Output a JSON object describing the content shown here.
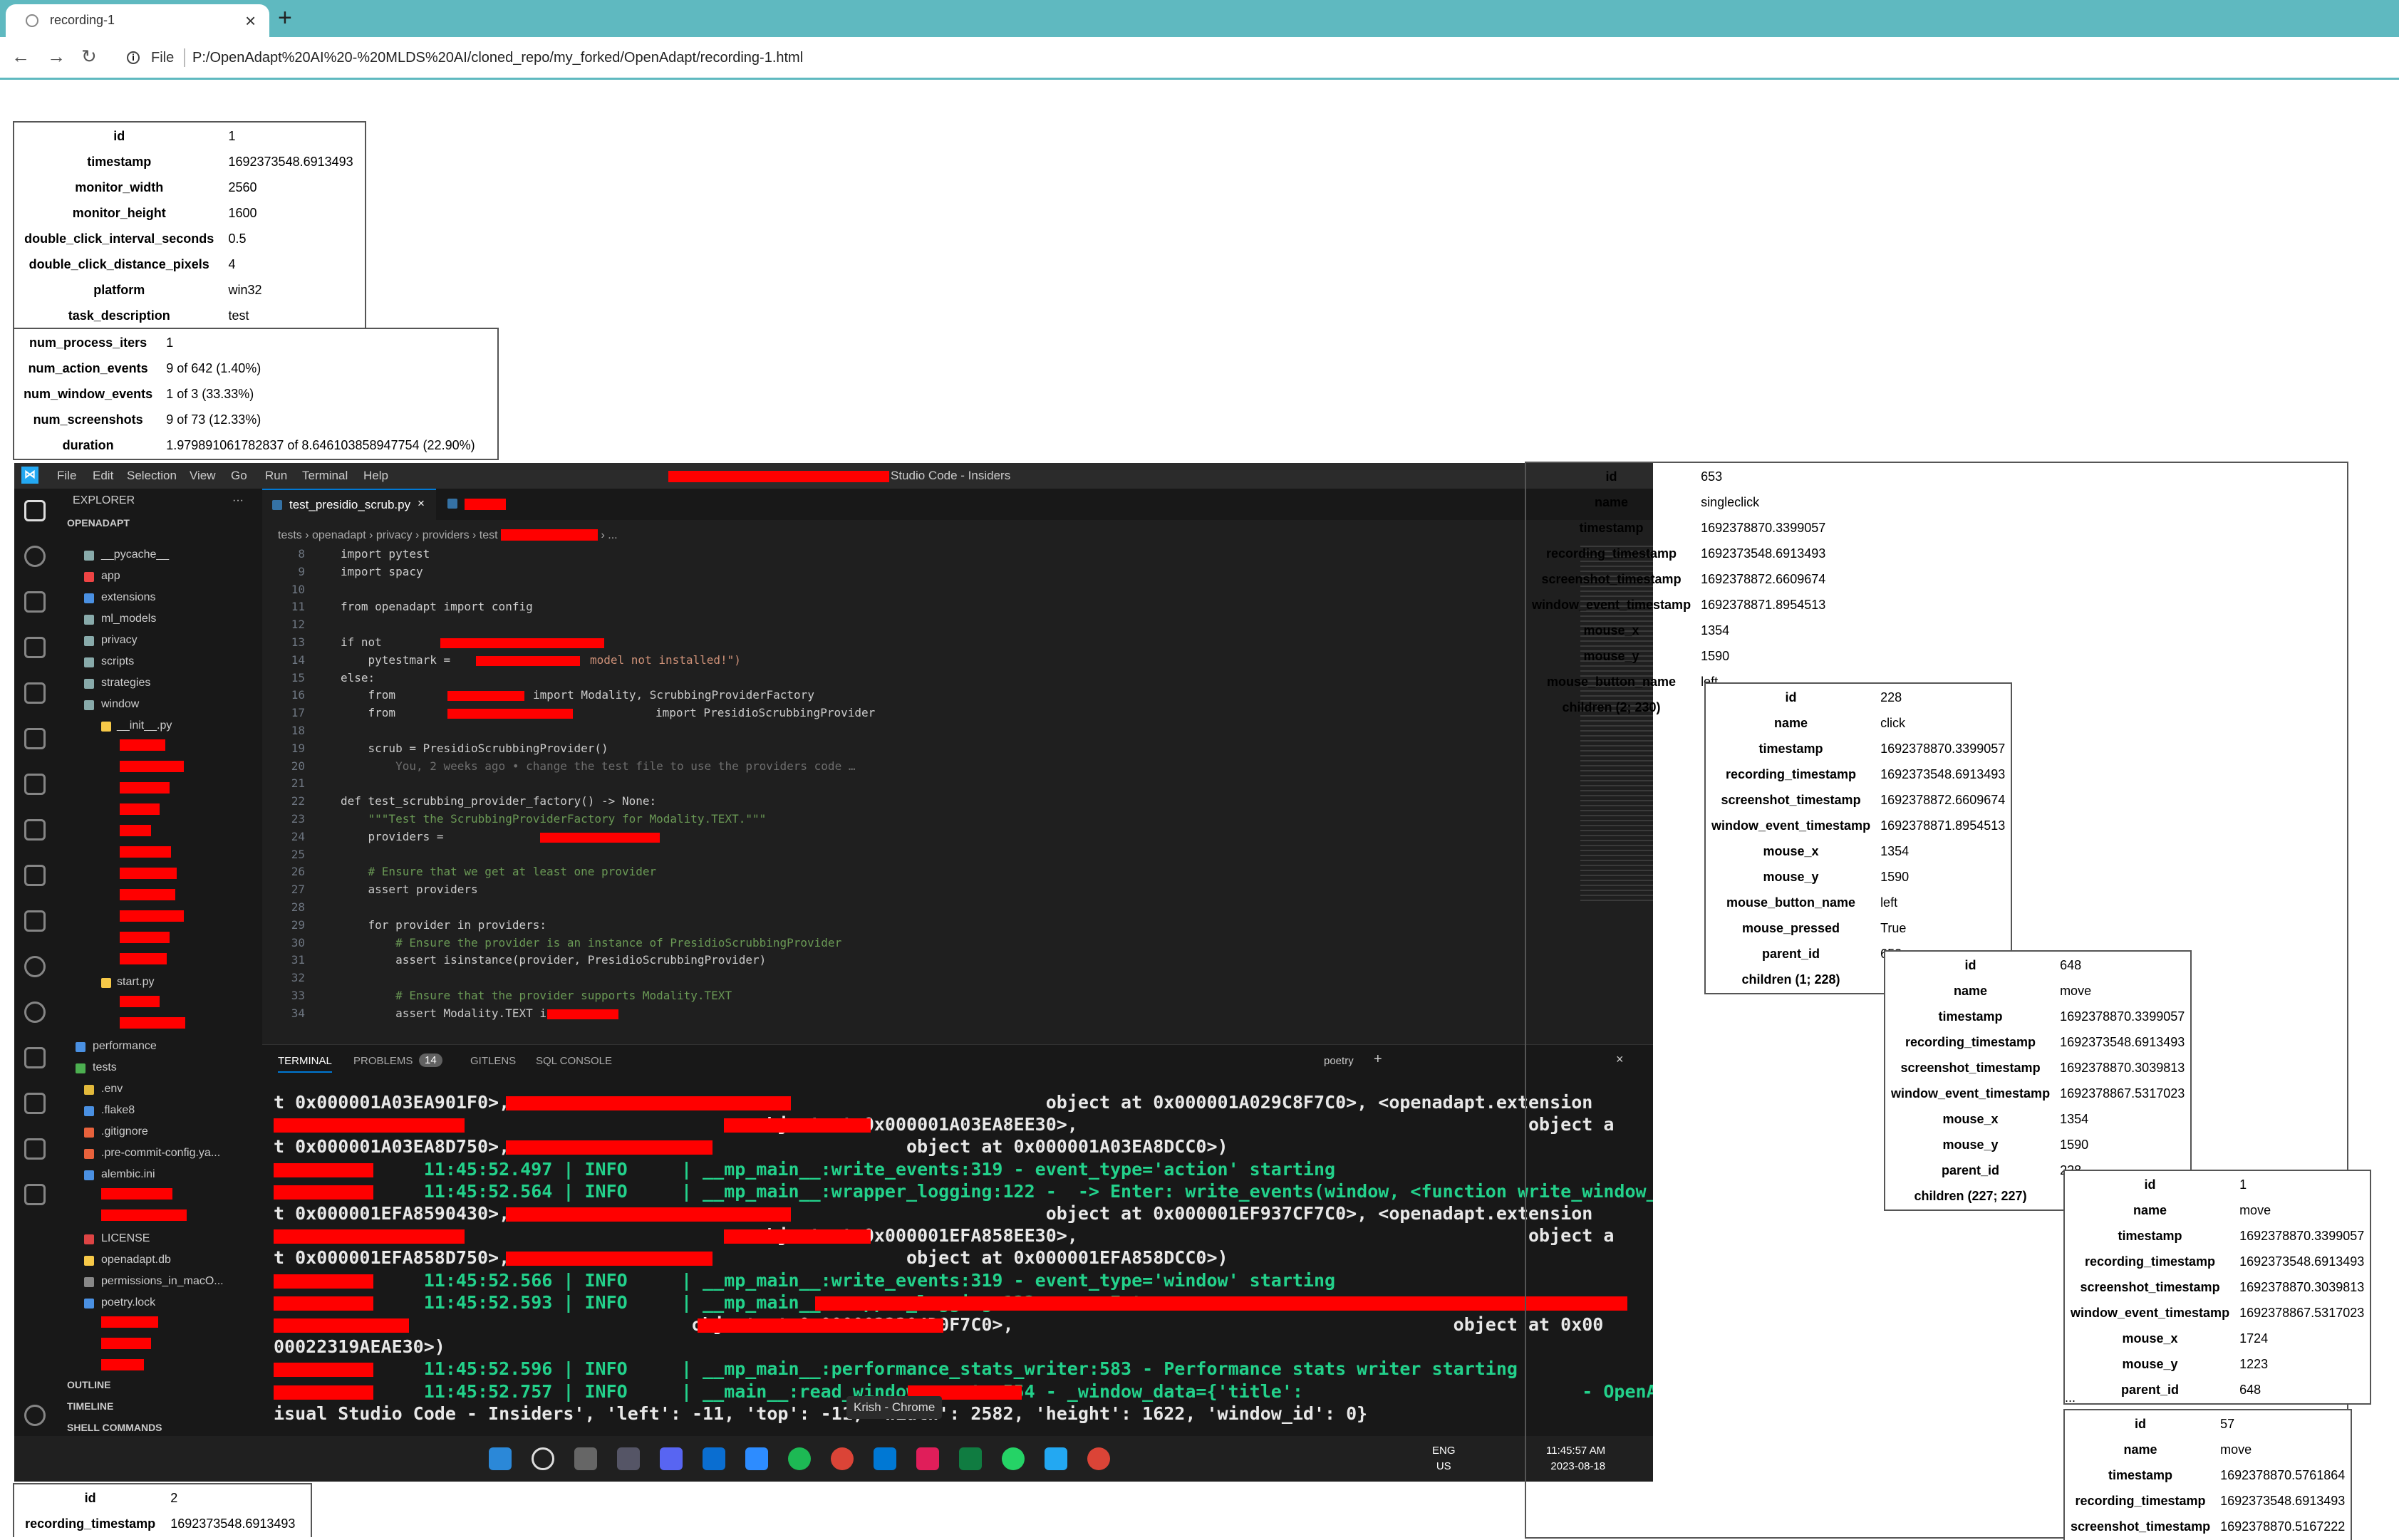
{
  "browser": {
    "tab_title": "recording-1",
    "tab_close": "×",
    "new_tab": "+",
    "back": "←",
    "forward": "→",
    "reload": "↻",
    "info_glyph": "i",
    "file_label": "File",
    "url": "P:/OpenAdapt%20AI%20-%20MLDS%20AI/cloned_repo/my_forked/OpenAdapt/recording-1.html"
  },
  "recording_table": [
    {
      "k": "id",
      "v": "1"
    },
    {
      "k": "timestamp",
      "v": "1692373548.6913493"
    },
    {
      "k": "monitor_width",
      "v": "2560"
    },
    {
      "k": "monitor_height",
      "v": "1600"
    },
    {
      "k": "double_click_interval_seconds",
      "v": "0.5"
    },
    {
      "k": "double_click_distance_pixels",
      "v": "4"
    },
    {
      "k": "platform",
      "v": "win32"
    },
    {
      "k": "task_description",
      "v": "test"
    }
  ],
  "stats_table": [
    {
      "k": "num_process_iters",
      "v": "1"
    },
    {
      "k": "num_action_events",
      "v": "9 of 642 (1.40%)"
    },
    {
      "k": "num_window_events",
      "v": "1 of 3 (33.33%)"
    },
    {
      "k": "num_screenshots",
      "v": "9 of 73 (12.33%)"
    },
    {
      "k": "duration",
      "v": "1.979891061782837 of 8.646103858947754 (22.90%)"
    }
  ],
  "bottom_table": [
    {
      "k": "id",
      "v": "2"
    },
    {
      "k": "recording_timestamp",
      "v": "1692373548.6913493"
    }
  ],
  "event_l1": [
    {
      "k": "id",
      "v": "653"
    },
    {
      "k": "name",
      "v": "singleclick"
    },
    {
      "k": "timestamp",
      "v": "1692378870.3399057"
    },
    {
      "k": "recording_timestamp",
      "v": "1692373548.6913493"
    },
    {
      "k": "screenshot_timestamp",
      "v": "1692378872.6609674"
    },
    {
      "k": "window_event_timestamp",
      "v": "1692378871.8954513"
    },
    {
      "k": "mouse_x",
      "v": "1354"
    },
    {
      "k": "mouse_y",
      "v": "1590"
    },
    {
      "k": "mouse_button_name",
      "v": "left"
    },
    {
      "k": "children (2; 230)",
      "v": ""
    }
  ],
  "event_l2": [
    {
      "k": "id",
      "v": "228"
    },
    {
      "k": "name",
      "v": "click"
    },
    {
      "k": "timestamp",
      "v": "1692378870.3399057"
    },
    {
      "k": "recording_timestamp",
      "v": "1692373548.6913493"
    },
    {
      "k": "screenshot_timestamp",
      "v": "1692378872.6609674"
    },
    {
      "k": "window_event_timestamp",
      "v": "1692378871.8954513"
    },
    {
      "k": "mouse_x",
      "v": "1354"
    },
    {
      "k": "mouse_y",
      "v": "1590"
    },
    {
      "k": "mouse_button_name",
      "v": "left"
    },
    {
      "k": "mouse_pressed",
      "v": "True"
    },
    {
      "k": "parent_id",
      "v": "653"
    },
    {
      "k": "children (1; 228)",
      "v": ""
    }
  ],
  "event_l3": [
    {
      "k": "id",
      "v": "648"
    },
    {
      "k": "name",
      "v": "move"
    },
    {
      "k": "timestamp",
      "v": "1692378870.3399057"
    },
    {
      "k": "recording_timestamp",
      "v": "1692373548.6913493"
    },
    {
      "k": "screenshot_timestamp",
      "v": "1692378870.3039813"
    },
    {
      "k": "window_event_timestamp",
      "v": "1692378867.5317023"
    },
    {
      "k": "mouse_x",
      "v": "1354"
    },
    {
      "k": "mouse_y",
      "v": "1590"
    },
    {
      "k": "parent_id",
      "v": "228"
    },
    {
      "k": "children (227; 227)",
      "v": ""
    }
  ],
  "event_l4a": [
    {
      "k": "id",
      "v": "1"
    },
    {
      "k": "name",
      "v": "move"
    },
    {
      "k": "timestamp",
      "v": "1692378870.3399057"
    },
    {
      "k": "recording_timestamp",
      "v": "1692373548.6913493"
    },
    {
      "k": "screenshot_timestamp",
      "v": "1692378870.3039813"
    },
    {
      "k": "window_event_timestamp",
      "v": "1692378867.5317023"
    },
    {
      "k": "mouse_x",
      "v": "1724"
    },
    {
      "k": "mouse_y",
      "v": "1223"
    },
    {
      "k": "parent_id",
      "v": "648"
    }
  ],
  "ellipsis": "...",
  "event_l4b": [
    {
      "k": "id",
      "v": "57"
    },
    {
      "k": "name",
      "v": "move"
    },
    {
      "k": "timestamp",
      "v": "1692378870.5761864"
    },
    {
      "k": "recording_timestamp",
      "v": "1692373548.6913493"
    },
    {
      "k": "screenshot_timestamp",
      "v": "1692378870.5167222"
    }
  ],
  "vscode": {
    "menu": [
      "File",
      "Edit",
      "Selection",
      "View",
      "Go",
      "Run",
      "Terminal",
      "Help"
    ],
    "window_title": "Studio Code - Insiders",
    "explorer_title": "EXPLORER",
    "explorer_more": "···",
    "root": "OPENADAPT",
    "folders": [
      "__pycache__",
      "app",
      "extensions",
      "ml_models",
      "privacy",
      "scripts",
      "strategies",
      "window"
    ],
    "init_file": "__init__.py",
    "start_file": "start.py",
    "folders2": [
      "performance",
      "tests"
    ],
    "files": [
      ".env",
      ".flake8",
      ".gitignore",
      ".pre-commit-config.ya...",
      "alembic.ini"
    ],
    "files2": [
      "LICENSE",
      "openadapt.db",
      "permissions_in_macO...",
      "poetry.lock"
    ],
    "sections": [
      "OUTLINE",
      "TIMELINE",
      "SHELL COMMANDS"
    ],
    "editor_tab": "test_presidio_scrub.py",
    "breadcrumb": "tests  ›  openadapt  ›  privacy  ›  providers  ›  test",
    "breadcrumb_tail": "›  ...",
    "code": [
      {
        "n": "8",
        "t": "import pytest"
      },
      {
        "n": "9",
        "t": "import spacy"
      },
      {
        "n": "10",
        "t": ""
      },
      {
        "n": "11",
        "t": "from openadapt import config"
      },
      {
        "n": "12",
        "t": ""
      },
      {
        "n": "13",
        "t": "if not"
      },
      {
        "n": "14",
        "t": "    pytestmark ="
      },
      {
        "n": "15",
        "t": "else:"
      },
      {
        "n": "16",
        "t": "    from"
      },
      {
        "n": "17",
        "t": "    from"
      },
      {
        "n": "18",
        "t": ""
      },
      {
        "n": "19",
        "t": "    scrub = PresidioScrubbingProvider()"
      },
      {
        "n": "20",
        "t": "        You, 2 weeks ago • change the test file to use the providers code …"
      },
      {
        "n": "21",
        "t": ""
      },
      {
        "n": "22",
        "t": "def test_scrubbing_provider_factory() -> None:"
      },
      {
        "n": "23",
        "t": "    \"\"\"Test the ScrubbingProviderFactory for Modality.TEXT.\"\"\""
      },
      {
        "n": "24",
        "t": "    providers ="
      },
      {
        "n": "25",
        "t": ""
      },
      {
        "n": "26",
        "t": "    # Ensure that we get at least one provider"
      },
      {
        "n": "27",
        "t": "    assert providers"
      },
      {
        "n": "28",
        "t": ""
      },
      {
        "n": "29",
        "t": "    for provider in providers:"
      },
      {
        "n": "30",
        "t": "        # Ensure the provider is an instance of PresidioScrubbingProvider"
      },
      {
        "n": "31",
        "t": "        assert isinstance(provider, PresidioScrubbingProvider)"
      },
      {
        "n": "32",
        "t": ""
      },
      {
        "n": "33",
        "t": "        # Ensure that the provider supports Modality.TEXT"
      },
      {
        "n": "34",
        "t": "        assert Modality.TEXT in"
      }
    ],
    "code_extra": {
      "l14": "model not installed!\")",
      "l16": "import Modality, ScrubbingProviderFactory",
      "l17": "import PresidioScrubbingProvider"
    },
    "panel_tabs": [
      "TERMINAL",
      "PROBLEMS",
      "14",
      "GITLENS",
      "SQL CONSOLE"
    ],
    "shell": "poetry",
    "terminal": [
      "t 0x000001A03EA901F0>,                                                  object at 0x000001A029C8F7C0>, <openadapt.extension",
      "                                             object at 0x000001A03EA8EE30>,                                          object a",
      "t 0x000001A03EA8D750>,                                     object at 0x000001A03EA8DCC0>)",
      "              11:45:52.497 | INFO     | __mp_main__:write_events:319 - event_type='action' starting",
      "              11:45:52.564 | INFO     | __mp_main__:wrapper_logging:122 -  -> Enter: write_events(window, <function write_window_event a",
      "t 0x000001EFA8590430>,                                                  object at 0x000001EF937CF7C0>, <openadapt.extension",
      "                                             object at 0x000001EFA858EE30>,                                          object a",
      "t 0x000001EFA858D750>,                                     object at 0x000001EFA858DCC0>)",
      "              11:45:52.566 | INFO     | __mp_main__:write_events:319 - event_type='window' starting",
      "              11:45:52.593 | INFO     | __mp_main__:wrapper_logging:122 -  -> Enter:",
      "                                       object at 0x0000022304D0F7C0>,                                         object at 0x00",
      "00022319AEAE30>)",
      "              11:45:52.596 | INFO     | __mp_main__:performance_stats_writer:583 - Performance stats writer starting",
      "              11:45:52.757 | INFO     | __main__:read_window_events:554 - _window_data={'title':                          - OpenAdapt - V",
      "isual Studio Code - Insiders', 'left': -11, 'top': -11, 'width': 2582, 'height': 1622, 'window_id': 0}"
    ],
    "tooltip": "Krish - Chrome",
    "lang": [
      "ENG",
      "US"
    ],
    "clock": [
      "11:45:57 AM",
      "2023-08-18"
    ]
  }
}
